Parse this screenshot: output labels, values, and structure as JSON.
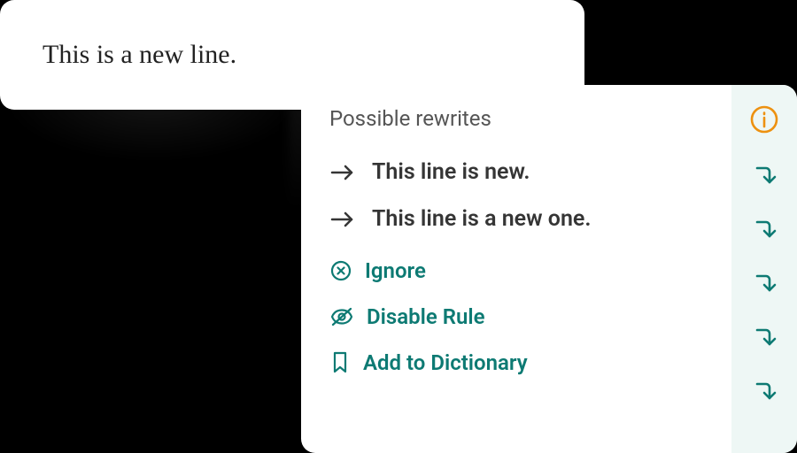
{
  "original": {
    "text": "This is a new line."
  },
  "popup": {
    "heading": "Possible rewrites",
    "suggestions": [
      {
        "text": "This line is new."
      },
      {
        "text": "This line is a new one."
      }
    ],
    "actions": {
      "ignore": "Ignore",
      "disable": "Disable Rule",
      "add_dict": "Add to Dictionary"
    }
  }
}
